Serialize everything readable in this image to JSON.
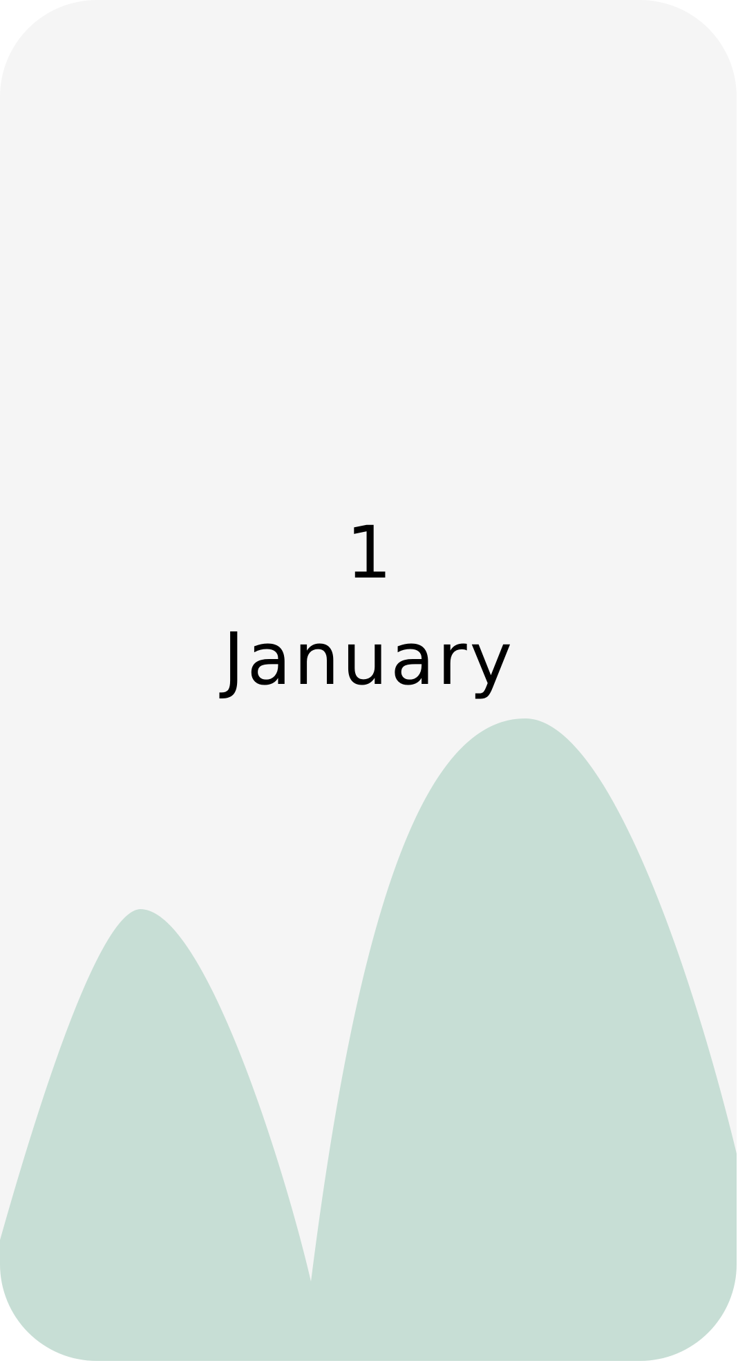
{
  "date_card": {
    "day": "1",
    "month": "January"
  },
  "colors": {
    "card_background": "#f5f5f5",
    "hill_fill": "#c7ded5",
    "text": "#000000"
  },
  "decoration": {
    "illustration": "hills-illustration"
  }
}
